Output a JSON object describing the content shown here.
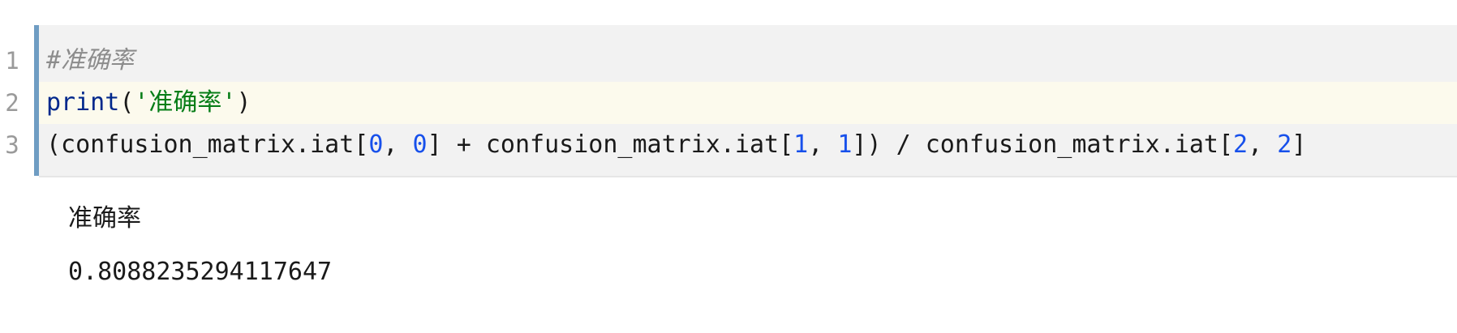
{
  "cell": {
    "line_numbers": [
      "1",
      "2",
      "3"
    ],
    "lines": [
      {
        "tokens": [
          {
            "text": "#准确率",
            "kind": "comment"
          }
        ]
      },
      {
        "tokens": [
          {
            "text": "print",
            "kind": "builtin"
          },
          {
            "text": "(",
            "kind": "plain"
          },
          {
            "text": "'准确率'",
            "kind": "string"
          },
          {
            "text": ")",
            "kind": "plain"
          }
        ]
      },
      {
        "tokens": [
          {
            "text": "(confusion_matrix.iat[",
            "kind": "plain"
          },
          {
            "text": "0",
            "kind": "number"
          },
          {
            "text": ", ",
            "kind": "plain"
          },
          {
            "text": "0",
            "kind": "number"
          },
          {
            "text": "] + confusion_matrix.iat[",
            "kind": "plain"
          },
          {
            "text": "1",
            "kind": "number"
          },
          {
            "text": ", ",
            "kind": "plain"
          },
          {
            "text": "1",
            "kind": "number"
          },
          {
            "text": "]) / confusion_matrix.iat[",
            "kind": "plain"
          },
          {
            "text": "2",
            "kind": "number"
          },
          {
            "text": ", ",
            "kind": "plain"
          },
          {
            "text": "2",
            "kind": "number"
          },
          {
            "text": "]",
            "kind": "plain"
          }
        ]
      }
    ],
    "current_line": 2
  },
  "output": {
    "lines": [
      "准确率",
      "0.8088235294117647"
    ]
  },
  "colors": {
    "editor_background": "#f2f2f2",
    "current_line_background": "#fcfaed",
    "accent_bar": "#6f9dc3",
    "comment": "#8c8c8c",
    "builtin": "#00288c",
    "string": "#067d17",
    "number": "#1750eb",
    "text": "#1a1a1a"
  }
}
